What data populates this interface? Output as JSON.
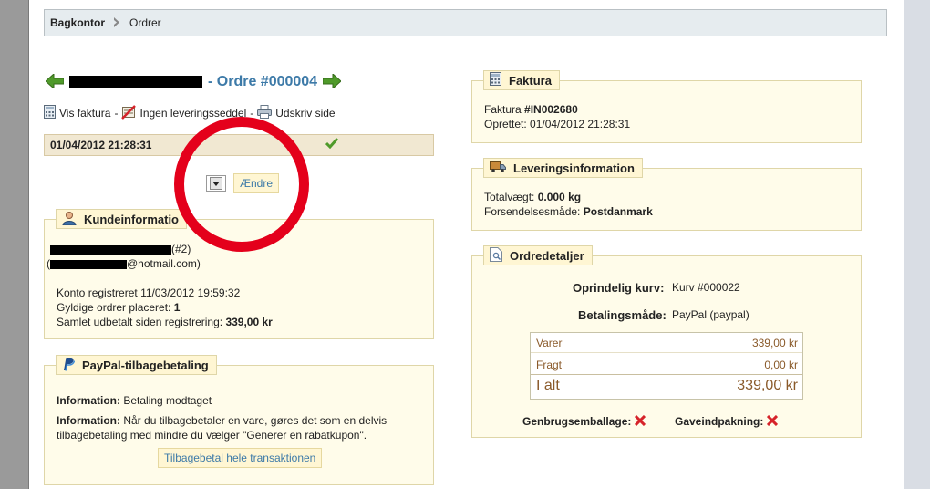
{
  "breadcrumb": {
    "root": "Bagkontor",
    "current": "Ordrer"
  },
  "order": {
    "title": "- Ordre #000004"
  },
  "links": {
    "view_invoice": "Vis faktura",
    "no_delivery_slip": "Ingen leveringsseddel",
    "print_page": "Udskriv side",
    "separator": "-"
  },
  "history": {
    "date": "01/04/2012 21:28:31"
  },
  "state_change": {
    "button": "Ændre"
  },
  "customer": {
    "legend": "Kundeinformatio",
    "id_suffix": "(#2)",
    "email_prefix": "(",
    "email_suffix": "@hotmail.com)",
    "registered_label": "Konto registreret",
    "registered_value": "11/03/2012 19:59:32",
    "valid_orders_label": "Gyldige ordrer placeret:",
    "valid_orders_value": "1",
    "total_paid_label": "Samlet udbetalt siden registrering:",
    "total_paid_value": "339,00 kr"
  },
  "paypal": {
    "legend": "PayPal-tilbagebetaling",
    "info1_label": "Information:",
    "info1_text": "Betaling modtaget",
    "info2_label": "Information:",
    "info2_line1": "Når du tilbagebetaler en vare, gøres det som en delvis",
    "info2_line2": "tilbagebetaling med mindre du vælger \"Generer en rabatkupon\".",
    "refund_button": "Tilbagebetal hele transaktionen"
  },
  "invoice": {
    "legend": "Faktura",
    "number_label": "Faktura",
    "number_value": "#IN002680",
    "created_label": "Oprettet:",
    "created_value": "01/04/2012 21:28:31"
  },
  "shipping": {
    "legend": "Leveringsinformation",
    "weight_label": "Totalvægt:",
    "weight_value": "0.000 kg",
    "method_label": "Forsendelsesmåde:",
    "method_value": "Postdanmark"
  },
  "details": {
    "legend": "Ordredetaljer",
    "cart_label": "Oprindelig kurv:",
    "cart_value": "Kurv #000022",
    "payment_label": "Betalingsmåde:",
    "payment_value": "PayPal (paypal)",
    "totals": [
      {
        "label": "Varer",
        "value": "339,00 kr"
      },
      {
        "label": "Fragt",
        "value": "0,00 kr"
      },
      {
        "label": "I alt",
        "value": "339,00 kr"
      }
    ],
    "recycled_label": "Genbrugsemballage:",
    "gift_label": "Gaveindpakning:"
  },
  "colors": {
    "title_blue": "#3d7aa8",
    "annotation_red": "#e4001b",
    "fieldset_bg": "#fffcea"
  },
  "icons": {
    "prev": "arrow-left-icon",
    "next": "arrow-right-icon",
    "invoice": "calculator-icon",
    "delivery": "delivery-slip-crossed-icon",
    "print": "printer-icon",
    "ok": "checkmark-icon",
    "customer": "user-icon",
    "paypal": "paypal-icon",
    "truck": "truck-icon",
    "details": "document-search-icon",
    "no": "x-icon"
  }
}
